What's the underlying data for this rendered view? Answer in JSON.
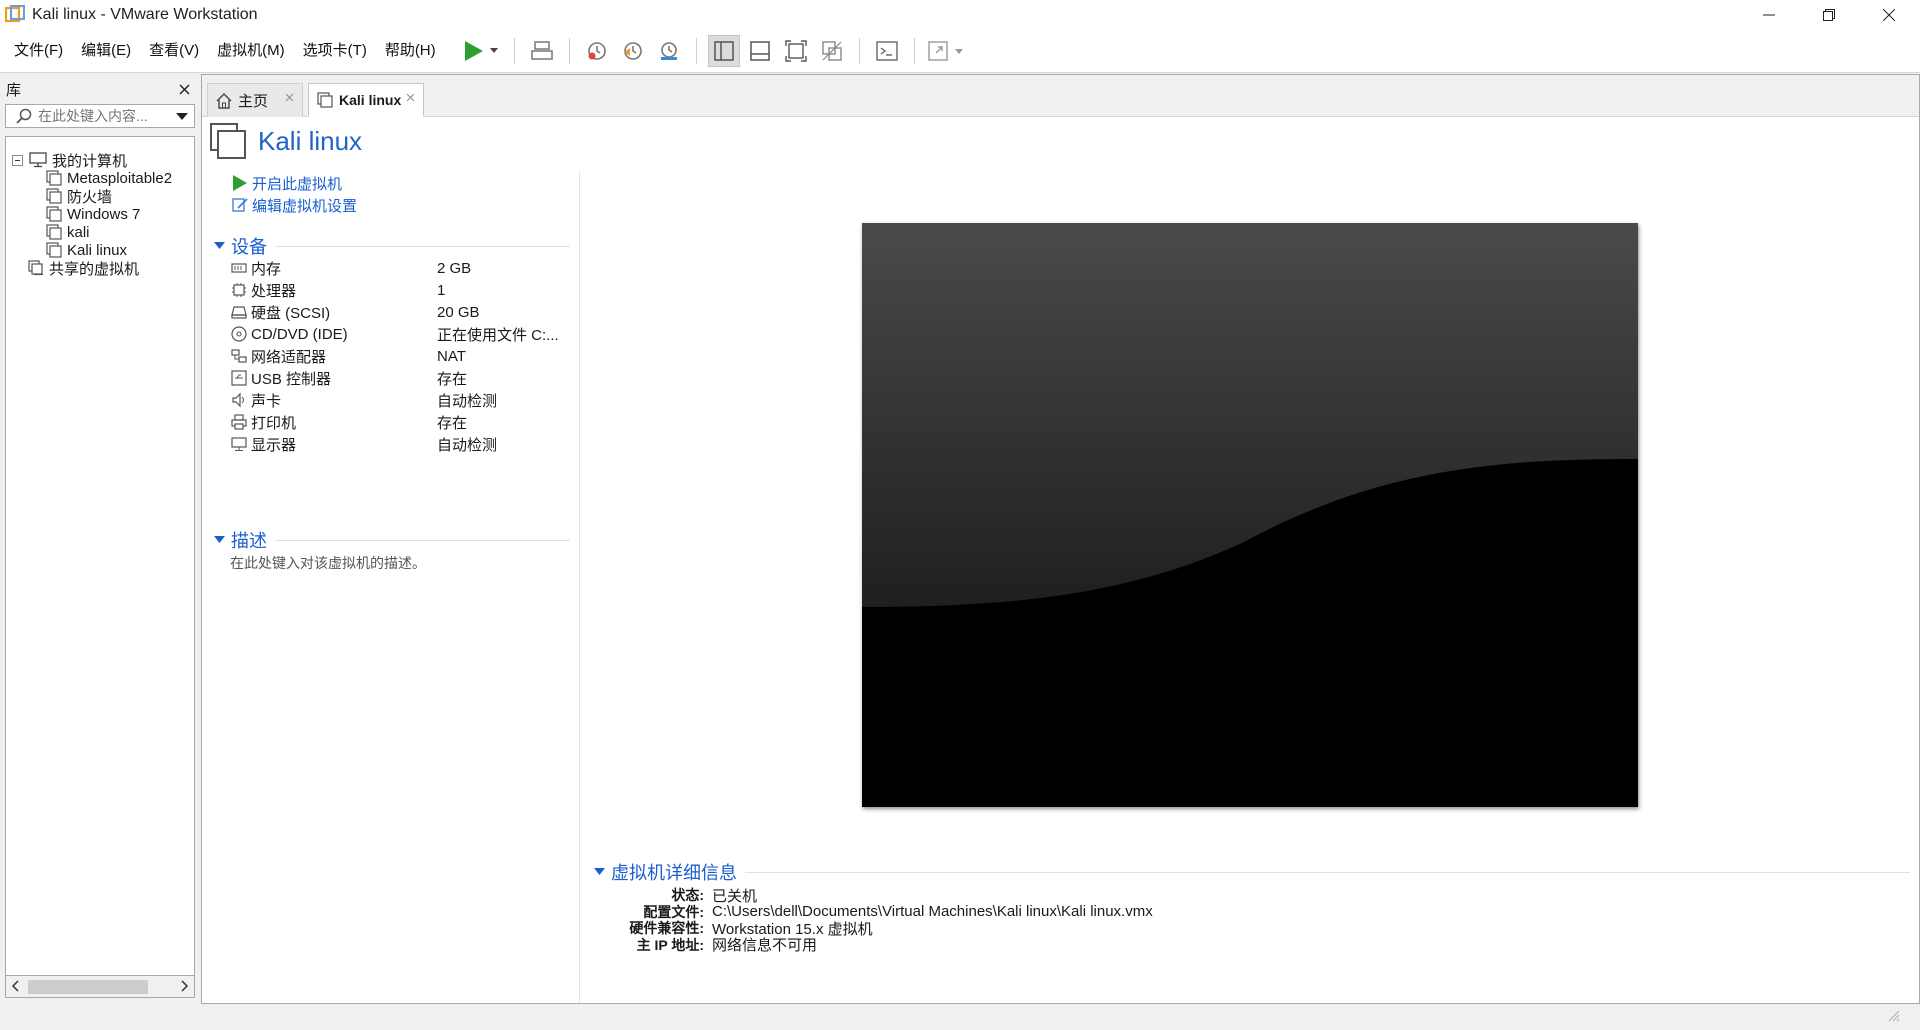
{
  "window": {
    "title": "Kali linux - VMware Workstation"
  },
  "menu": [
    {
      "label": "文件(F)"
    },
    {
      "label": "编辑(E)"
    },
    {
      "label": "查看(V)"
    },
    {
      "label": "虚拟机(M)"
    },
    {
      "label": "选项卡(T)"
    },
    {
      "label": "帮助(H)"
    }
  ],
  "library": {
    "title": "库",
    "search_placeholder": "在此处键入内容...",
    "tree": {
      "root": "我的计算机",
      "vms": [
        "Metasploitable2",
        "防火墙",
        "Windows 7",
        "kali",
        "Kali linux"
      ],
      "shared": "共享的虚拟机"
    }
  },
  "tabs": [
    {
      "label": "主页"
    },
    {
      "label": "Kali linux"
    }
  ],
  "vm": {
    "name": "Kali linux",
    "actions": {
      "power_on": "开启此虚拟机",
      "edit_settings": "编辑虚拟机设置"
    },
    "devices_title": "设备",
    "devices": [
      {
        "label": "内存",
        "value": "2 GB",
        "icon": "memory-icon"
      },
      {
        "label": "处理器",
        "value": "1",
        "icon": "cpu-icon"
      },
      {
        "label": "硬盘 (SCSI)",
        "value": "20 GB",
        "icon": "hard-disk-icon"
      },
      {
        "label": "CD/DVD (IDE)",
        "value": "正在使用文件 C:...",
        "icon": "cd-dvd-icon"
      },
      {
        "label": "网络适配器",
        "value": "NAT",
        "icon": "network-adapter-icon"
      },
      {
        "label": "USB 控制器",
        "value": "存在",
        "icon": "usb-icon"
      },
      {
        "label": "声卡",
        "value": "自动检测",
        "icon": "sound-icon"
      },
      {
        "label": "打印机",
        "value": "存在",
        "icon": "printer-icon"
      },
      {
        "label": "显示器",
        "value": "自动检测",
        "icon": "display-icon"
      }
    ],
    "description_title": "描述",
    "description_hint": "在此处键入对该虚拟机的描述。",
    "details_title": "虚拟机详细信息",
    "details": [
      {
        "key": "状态:",
        "value": "已关机"
      },
      {
        "key": "配置文件:",
        "value": "C:\\Users\\dell\\Documents\\Virtual Machines\\Kali linux\\Kali linux.vmx"
      },
      {
        "key": "硬件兼容性:",
        "value": "Workstation 15.x 虚拟机"
      },
      {
        "key": "主 IP 地址:",
        "value": "网络信息不可用"
      }
    ]
  },
  "colors": {
    "accent": "#1f63c6",
    "play": "#2e9e2e"
  }
}
